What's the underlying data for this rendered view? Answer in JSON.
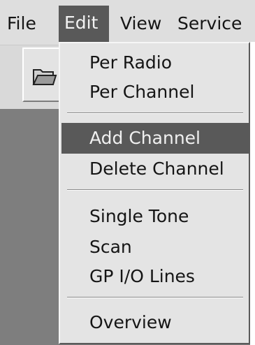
{
  "menubar": {
    "items": [
      {
        "label": "File",
        "active": false
      },
      {
        "label": "Edit",
        "active": true
      },
      {
        "label": "View",
        "active": false
      },
      {
        "label": "Service",
        "active": false
      }
    ]
  },
  "edit_menu": {
    "items": [
      {
        "label": "Per Radio"
      },
      {
        "label": "Per Channel"
      },
      {
        "label": "Add Channel",
        "highlighted": true
      },
      {
        "label": "Delete Channel"
      },
      {
        "label": "Single Tone"
      },
      {
        "label": "Scan"
      },
      {
        "label": "GP I/O Lines"
      },
      {
        "label": "Overview"
      }
    ]
  },
  "toolbar": {
    "icon": "open-folder-icon"
  }
}
